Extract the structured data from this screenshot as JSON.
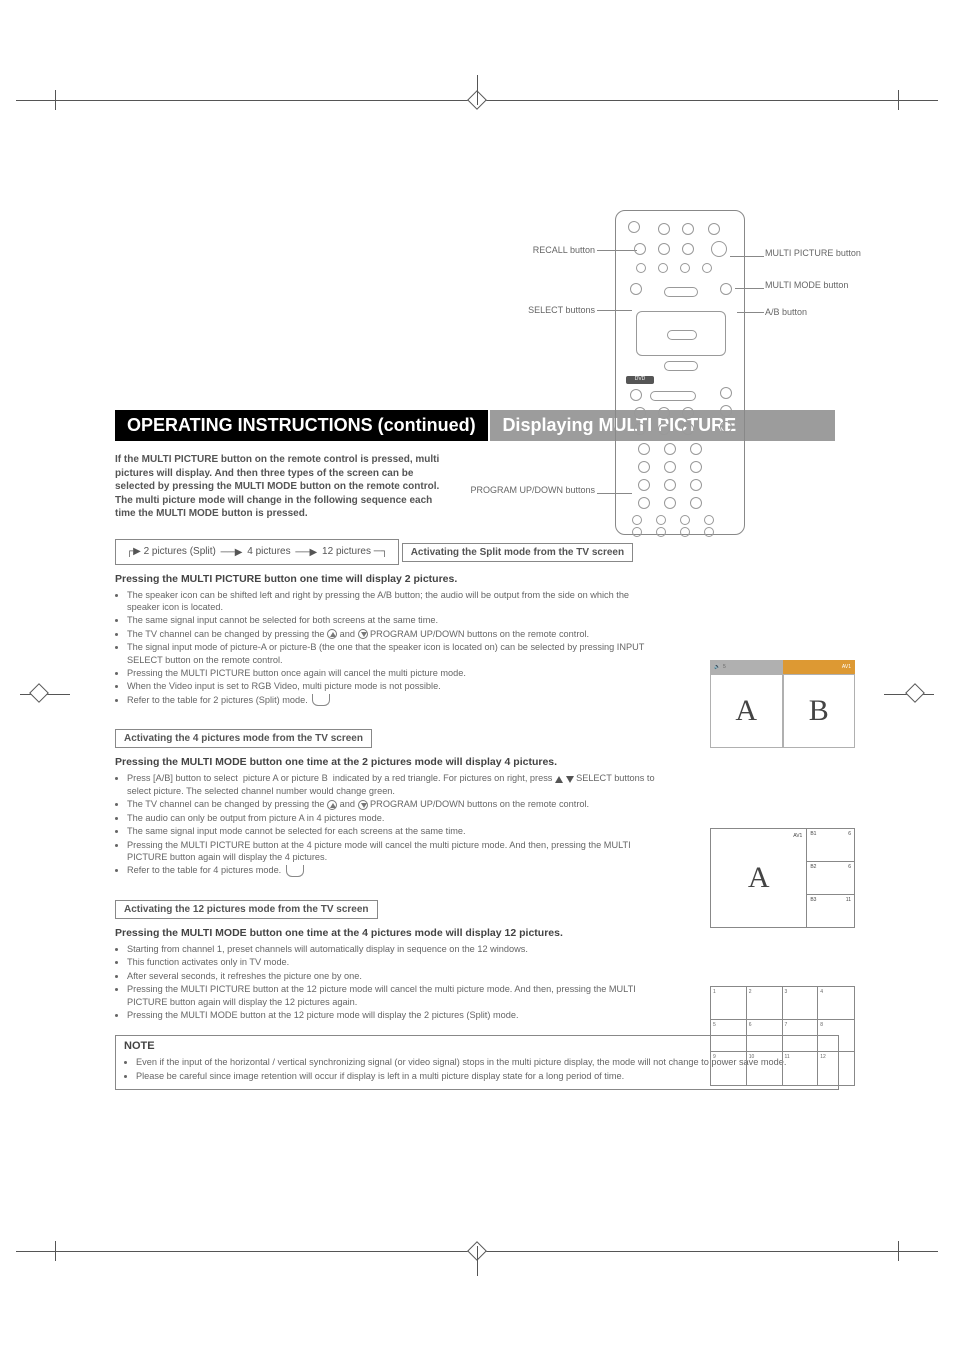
{
  "title": "OPERATING INSTRUCTIONS (continued)",
  "section_title": "Displaying MULTI PICTURE",
  "intro": "If the MULTI PICTURE button on the remote control is pressed, multi pictures will display. And then three types of the screen can be selected by pressing the MULTI MODE button on the remote control.\nThe multi picture mode will change in the following sequence each time the MULTI MODE button is pressed.",
  "flow": {
    "a": "2 pictures (Split)",
    "b": "4 pictures",
    "c": "12 pictures"
  },
  "remote": {
    "labels": {
      "recall": "RECALL button",
      "select": "SELECT buttons",
      "program": "PROGRAM UP/DOWN buttons",
      "multi_picture": "MULTI PICTURE button",
      "multi_mode": "MULTI MODE button",
      "ab": "A/B button"
    }
  },
  "split": {
    "box": "Activating the Split mode from the TV screen",
    "heading": "Pressing the MULTI PICTURE button one time will display 2 pictures.",
    "bullets": [
      "The speaker icon can be shifted left and right by pressing the A/B button; the audio will be output from the side on which the speaker icon is located.",
      "The same signal input cannot be selected for both screens at the same time.",
      "The TV channel can be changed by pressing the ⊕ and ⊖ PROGRAM UP/DOWN buttons on the remote control.",
      "The signal input mode of picture-A or picture-B (the one that the speaker icon is located on) can be selected by pressing INPUT SELECT button on the remote control.",
      "Pressing the MULTI PICTURE button once again will cancel the multi picture mode.",
      "When the Video input is set to RGB Video, multi picture mode is not possible.",
      "Refer to the table for 2 pictures (Split) mode."
    ],
    "illus": {
      "left_tag_speaker": "🔊",
      "left_tag_ch": "5",
      "right_tag": "AV1",
      "A": "A",
      "B": "B"
    }
  },
  "four": {
    "box": "Activating the 4 pictures mode from the TV screen",
    "heading": "Pressing the MULTI MODE button one time at the 2 pictures mode will display 4 pictures.",
    "bullets": [
      "Press [A/B] button to select  picture A or picture B  indicated by a red triangle. For pictures on right, press ▲ ▼ SELECT buttons to select picture. The selected channel number would change green.",
      "The TV channel can be changed by pressing the ⊕ and ⊖ PROGRAM UP/DOWN buttons on the remote control.",
      "The audio can only be output from picture A in 4 pictures mode.",
      "The same signal input mode cannot be selected for each screens at the same time.",
      "Pressing the MULTI PICTURE button at the 4 picture mode will cancel the multi picture mode. And then, pressing the MULTI PICTURE button again will display the 4 pictures.",
      "Refer to the table for 4 pictures mode."
    ],
    "illus": {
      "A": "A",
      "A_tag": "AV1",
      "rows": [
        {
          "name": "B1",
          "ch": "6"
        },
        {
          "name": "B2",
          "ch": "6"
        },
        {
          "name": "B3",
          "ch": "11"
        }
      ]
    }
  },
  "twelve": {
    "box": "Activating the 12 pictures mode from the TV screen",
    "heading": "Pressing the MULTI MODE button one time at the 4 pictures mode will display 12 pictures.",
    "bullets": [
      "Starting from channel 1, preset channels will automatically display in sequence on the 12 windows.",
      "This function activates only in TV mode.",
      "After several seconds, it refreshes the picture one by one.",
      "Pressing the MULTI PICTURE button at the 12 picture mode will cancel the multi picture mode. And then, pressing the MULTI PICTURE button again will display the 12 pictures again.",
      "Pressing the MULTI MODE button at the 12 picture mode will display the 2 pictures (Split) mode."
    ],
    "cells": [
      "1",
      "2",
      "3",
      "4",
      "5",
      "6",
      "7",
      "8",
      "9",
      "10",
      "11",
      "12"
    ]
  },
  "note": {
    "title": "NOTE",
    "bullets": [
      "Even if the input of the horizontal / vertical synchronizing signal (or video signal) stops in the multi picture display, the mode will not change to power save mode.",
      "Please be careful since image retention will occur if display is left in a multi picture display state for a long period of time."
    ]
  }
}
